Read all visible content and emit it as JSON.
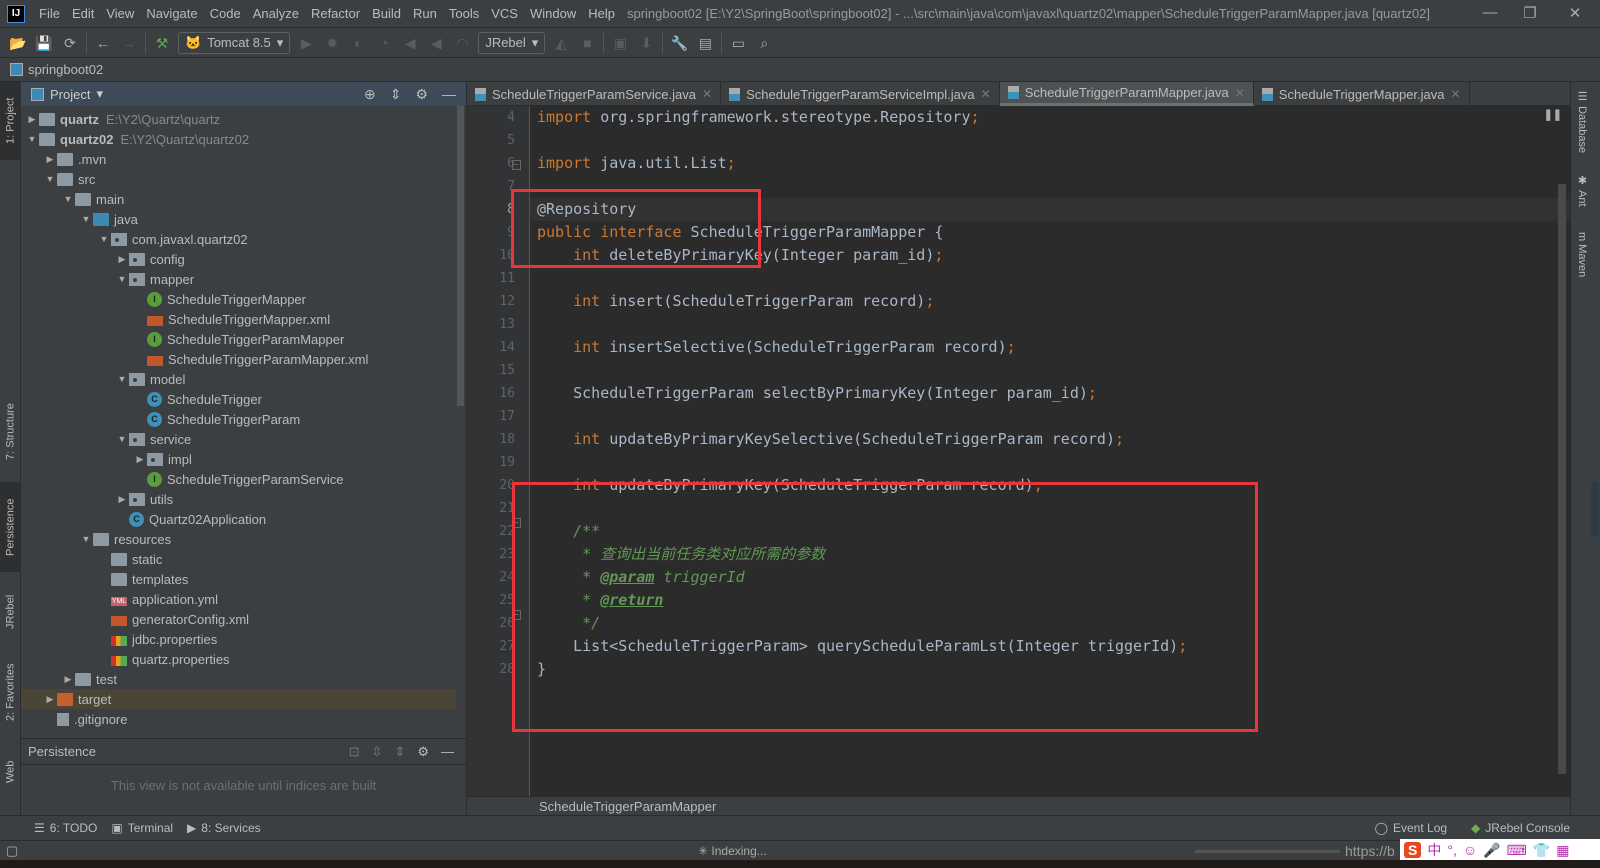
{
  "app": {
    "logo": "IJ",
    "title": "springboot02 [E:\\Y2\\SpringBoot\\springboot02] - ...\\src\\main\\java\\com\\javaxl\\quartz02\\mapper\\ScheduleTriggerParamMapper.java [quartz02]"
  },
  "menu": [
    "File",
    "Edit",
    "View",
    "Navigate",
    "Code",
    "Analyze",
    "Refactor",
    "Build",
    "Run",
    "Tools",
    "VCS",
    "Window",
    "Help"
  ],
  "toolbar": {
    "run_config": "Tomcat 8.5",
    "jrebel": "JRebel"
  },
  "navbar": {
    "project": "springboot02"
  },
  "left_tabs": [
    "1: Project",
    "7: Structure",
    "Persistence",
    "JRebel",
    "2: Favorites",
    "Web"
  ],
  "right_tabs": [
    "Database",
    "Ant",
    "Maven"
  ],
  "project_panel": {
    "title": "Project",
    "tree": [
      {
        "label": "quartz",
        "path": "E:\\Y2\\Quartz\\quartz",
        "icon": "module",
        "depth": 0,
        "arrow": "right",
        "bold": true
      },
      {
        "label": "quartz02",
        "path": "E:\\Y2\\Quartz\\quartz02",
        "icon": "module",
        "depth": 0,
        "arrow": "down",
        "bold": true
      },
      {
        "label": ".mvn",
        "icon": "folder",
        "depth": 1,
        "arrow": "right"
      },
      {
        "label": "src",
        "icon": "folder",
        "depth": 1,
        "arrow": "down"
      },
      {
        "label": "main",
        "icon": "folder",
        "depth": 2,
        "arrow": "down"
      },
      {
        "label": "java",
        "icon": "folder-blue",
        "depth": 3,
        "arrow": "down"
      },
      {
        "label": "com.javaxl.quartz02",
        "icon": "package",
        "depth": 4,
        "arrow": "down"
      },
      {
        "label": "config",
        "icon": "package",
        "depth": 5,
        "arrow": "right"
      },
      {
        "label": "mapper",
        "icon": "package",
        "depth": 5,
        "arrow": "down"
      },
      {
        "label": "ScheduleTriggerMapper",
        "icon": "interface",
        "depth": 6
      },
      {
        "label": "ScheduleTriggerMapper.xml",
        "icon": "xml",
        "depth": 6
      },
      {
        "label": "ScheduleTriggerParamMapper",
        "icon": "interface",
        "depth": 6
      },
      {
        "label": "ScheduleTriggerParamMapper.xml",
        "icon": "xml",
        "depth": 6
      },
      {
        "label": "model",
        "icon": "package",
        "depth": 5,
        "arrow": "down"
      },
      {
        "label": "ScheduleTrigger",
        "icon": "class",
        "depth": 6
      },
      {
        "label": "ScheduleTriggerParam",
        "icon": "class",
        "depth": 6
      },
      {
        "label": "service",
        "icon": "package",
        "depth": 5,
        "arrow": "down"
      },
      {
        "label": "impl",
        "icon": "package",
        "depth": 6,
        "arrow": "right"
      },
      {
        "label": "ScheduleTriggerParamService",
        "icon": "interface",
        "depth": 6
      },
      {
        "label": "utils",
        "icon": "package",
        "depth": 5,
        "arrow": "right"
      },
      {
        "label": "Quartz02Application",
        "icon": "class",
        "depth": 5
      },
      {
        "label": "resources",
        "icon": "folder",
        "depth": 3,
        "arrow": "down"
      },
      {
        "label": "static",
        "icon": "folder",
        "depth": 4
      },
      {
        "label": "templates",
        "icon": "folder",
        "depth": 4
      },
      {
        "label": "application.yml",
        "icon": "yml",
        "depth": 4
      },
      {
        "label": "generatorConfig.xml",
        "icon": "xml",
        "depth": 4
      },
      {
        "label": "jdbc.properties",
        "icon": "properties",
        "depth": 4
      },
      {
        "label": "quartz.properties",
        "icon": "properties",
        "depth": 4
      },
      {
        "label": "test",
        "icon": "folder",
        "depth": 2,
        "arrow": "right"
      },
      {
        "label": "target",
        "icon": "folder-orange",
        "depth": 1,
        "arrow": "right",
        "highlight": true
      },
      {
        "label": ".gitignore",
        "icon": "gitignore",
        "depth": 1
      }
    ]
  },
  "persistence": {
    "title": "Persistence",
    "message": "This view is not available until indices are built"
  },
  "tabs": [
    {
      "label": "ScheduleTriggerParamService.java",
      "selected": false
    },
    {
      "label": "ScheduleTriggerParamServiceImpl.java",
      "selected": false
    },
    {
      "label": "ScheduleTriggerParamMapper.java",
      "selected": true
    },
    {
      "label": "ScheduleTriggerMapper.java",
      "selected": false
    }
  ],
  "editor": {
    "current_line": 8,
    "lines": [
      {
        "n": "4",
        "seg": [
          [
            "kw",
            "import "
          ],
          [
            "",
            "org.springframework.stereotype.Repository"
          ],
          [
            "pn",
            ";"
          ]
        ]
      },
      {
        "n": "5",
        "seg": []
      },
      {
        "n": "6",
        "seg": [
          [
            "kw",
            "import "
          ],
          [
            "",
            "java.util.List"
          ],
          [
            "pn",
            ";"
          ]
        ]
      },
      {
        "n": "7",
        "seg": []
      },
      {
        "n": "8",
        "seg": [
          [
            "an2",
            "@Repository"
          ]
        ]
      },
      {
        "n": "9",
        "seg": [
          [
            "kw",
            "public interface "
          ],
          [
            "",
            "ScheduleTriggerParamMapper {"
          ]
        ]
      },
      {
        "n": "10",
        "seg": [
          [
            "kw",
            "    int "
          ],
          [
            "",
            "deleteByPrimaryKey(Integer param_id)"
          ],
          [
            "pn",
            ";"
          ]
        ]
      },
      {
        "n": "11",
        "seg": []
      },
      {
        "n": "12",
        "seg": [
          [
            "kw",
            "    int "
          ],
          [
            "",
            "insert(ScheduleTriggerParam record)"
          ],
          [
            "pn",
            ";"
          ]
        ]
      },
      {
        "n": "13",
        "seg": []
      },
      {
        "n": "14",
        "seg": [
          [
            "kw",
            "    int "
          ],
          [
            "",
            "insertSelective(ScheduleTriggerParam record)"
          ],
          [
            "pn",
            ";"
          ]
        ]
      },
      {
        "n": "15",
        "seg": []
      },
      {
        "n": "16",
        "seg": [
          [
            "",
            "    ScheduleTriggerParam selectByPrimaryKey(Integer param_id)"
          ],
          [
            "pn",
            ";"
          ]
        ]
      },
      {
        "n": "17",
        "seg": []
      },
      {
        "n": "18",
        "seg": [
          [
            "kw",
            "    int "
          ],
          [
            "",
            "updateByPrimaryKeySelective(ScheduleTriggerParam record)"
          ],
          [
            "pn",
            ";"
          ]
        ]
      },
      {
        "n": "19",
        "seg": []
      },
      {
        "n": "20",
        "seg": [
          [
            "kw",
            "    int "
          ],
          [
            "",
            "updateByPrimaryKey(ScheduleTriggerParam record)"
          ],
          [
            "pn",
            ";"
          ]
        ]
      },
      {
        "n": "21",
        "seg": []
      },
      {
        "n": "22",
        "seg": [
          [
            "cm",
            "    /**"
          ]
        ]
      },
      {
        "n": "23",
        "seg": [
          [
            "cm",
            "     * 查询出当前任务类对应所需的参数"
          ]
        ]
      },
      {
        "n": "24",
        "seg": [
          [
            "cm",
            "     * "
          ],
          [
            "tag",
            "@param"
          ],
          [
            "cm",
            " triggerId"
          ]
        ]
      },
      {
        "n": "25",
        "seg": [
          [
            "cm",
            "     * "
          ],
          [
            "tag",
            "@return"
          ]
        ]
      },
      {
        "n": "26",
        "seg": [
          [
            "cm",
            "     */"
          ]
        ]
      },
      {
        "n": "27",
        "seg": [
          [
            "",
            "    List<ScheduleTriggerParam> queryScheduleParamLst(Integer triggerId)"
          ],
          [
            "pn",
            ";"
          ]
        ]
      },
      {
        "n": "28",
        "seg": [
          [
            "",
            "}"
          ]
        ]
      }
    ]
  },
  "breadcrumb": "ScheduleTriggerParamMapper",
  "bottom_tools": [
    {
      "label": "6: TODO",
      "icon": "list-icon"
    },
    {
      "label": "Terminal",
      "icon": "terminal-icon"
    },
    {
      "label": "8: Services",
      "icon": "services-icon"
    }
  ],
  "bottom_right": {
    "event_log": "Event Log",
    "jrebel_console": "JRebel Console"
  },
  "status": {
    "indexing": "Indexing...",
    "url_fragment": "https://b"
  },
  "colors": {
    "annotation_box": "#e8363b",
    "keyword": "#cc7832",
    "comment": "#629755",
    "text": "#a9b7c6"
  }
}
